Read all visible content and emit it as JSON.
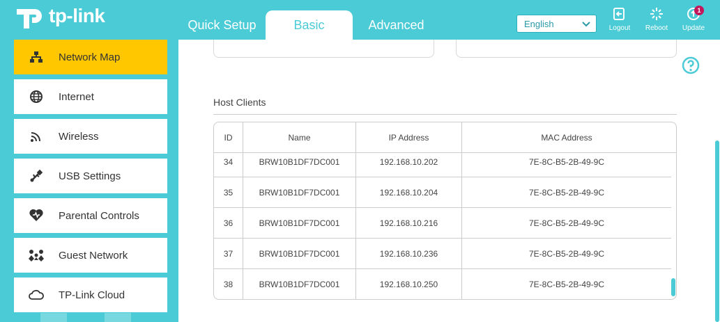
{
  "brand": {
    "logo_text": "tp-link"
  },
  "tabs": [
    {
      "label": "Quick Setup",
      "active": false
    },
    {
      "label": "Basic",
      "active": true
    },
    {
      "label": "Advanced",
      "active": false
    }
  ],
  "language": {
    "selected": "English"
  },
  "header_buttons": {
    "logout": "Logout",
    "reboot": "Reboot",
    "update": "Update",
    "update_badge": "1"
  },
  "sidebar": {
    "items": [
      {
        "label": "Network Map",
        "icon": "network-map-icon",
        "active": true
      },
      {
        "label": "Internet",
        "icon": "globe-icon",
        "active": false
      },
      {
        "label": "Wireless",
        "icon": "wireless-icon",
        "active": false
      },
      {
        "label": "USB Settings",
        "icon": "usb-icon",
        "active": false
      },
      {
        "label": "Parental Controls",
        "icon": "heart-icon",
        "active": false
      },
      {
        "label": "Guest Network",
        "icon": "guest-icon",
        "active": false
      },
      {
        "label": "TP-Link Cloud",
        "icon": "cloud-icon",
        "active": false
      }
    ]
  },
  "host_clients": {
    "title": "Host Clients",
    "columns": [
      "ID",
      "Name",
      "IP Address",
      "MAC Address"
    ],
    "rows": [
      [
        "34",
        "BRW10B1DF7DC001",
        "192.168.10.202",
        "7E-8C-B5-2B-49-9C"
      ],
      [
        "35",
        "BRW10B1DF7DC001",
        "192.168.10.204",
        "7E-8C-B5-2B-49-9C"
      ],
      [
        "36",
        "BRW10B1DF7DC001",
        "192.168.10.216",
        "7E-8C-B5-2B-49-9C"
      ],
      [
        "37",
        "BRW10B1DF7DC001",
        "192.168.10.236",
        "7E-8C-B5-2B-49-9C"
      ],
      [
        "38",
        "BRW10B1DF7DC001",
        "192.168.10.250",
        "7E-8C-B5-2B-49-9C"
      ]
    ]
  },
  "colors": {
    "accent": "#4acbd6",
    "active": "#ffc700",
    "badge": "#c2185b"
  }
}
